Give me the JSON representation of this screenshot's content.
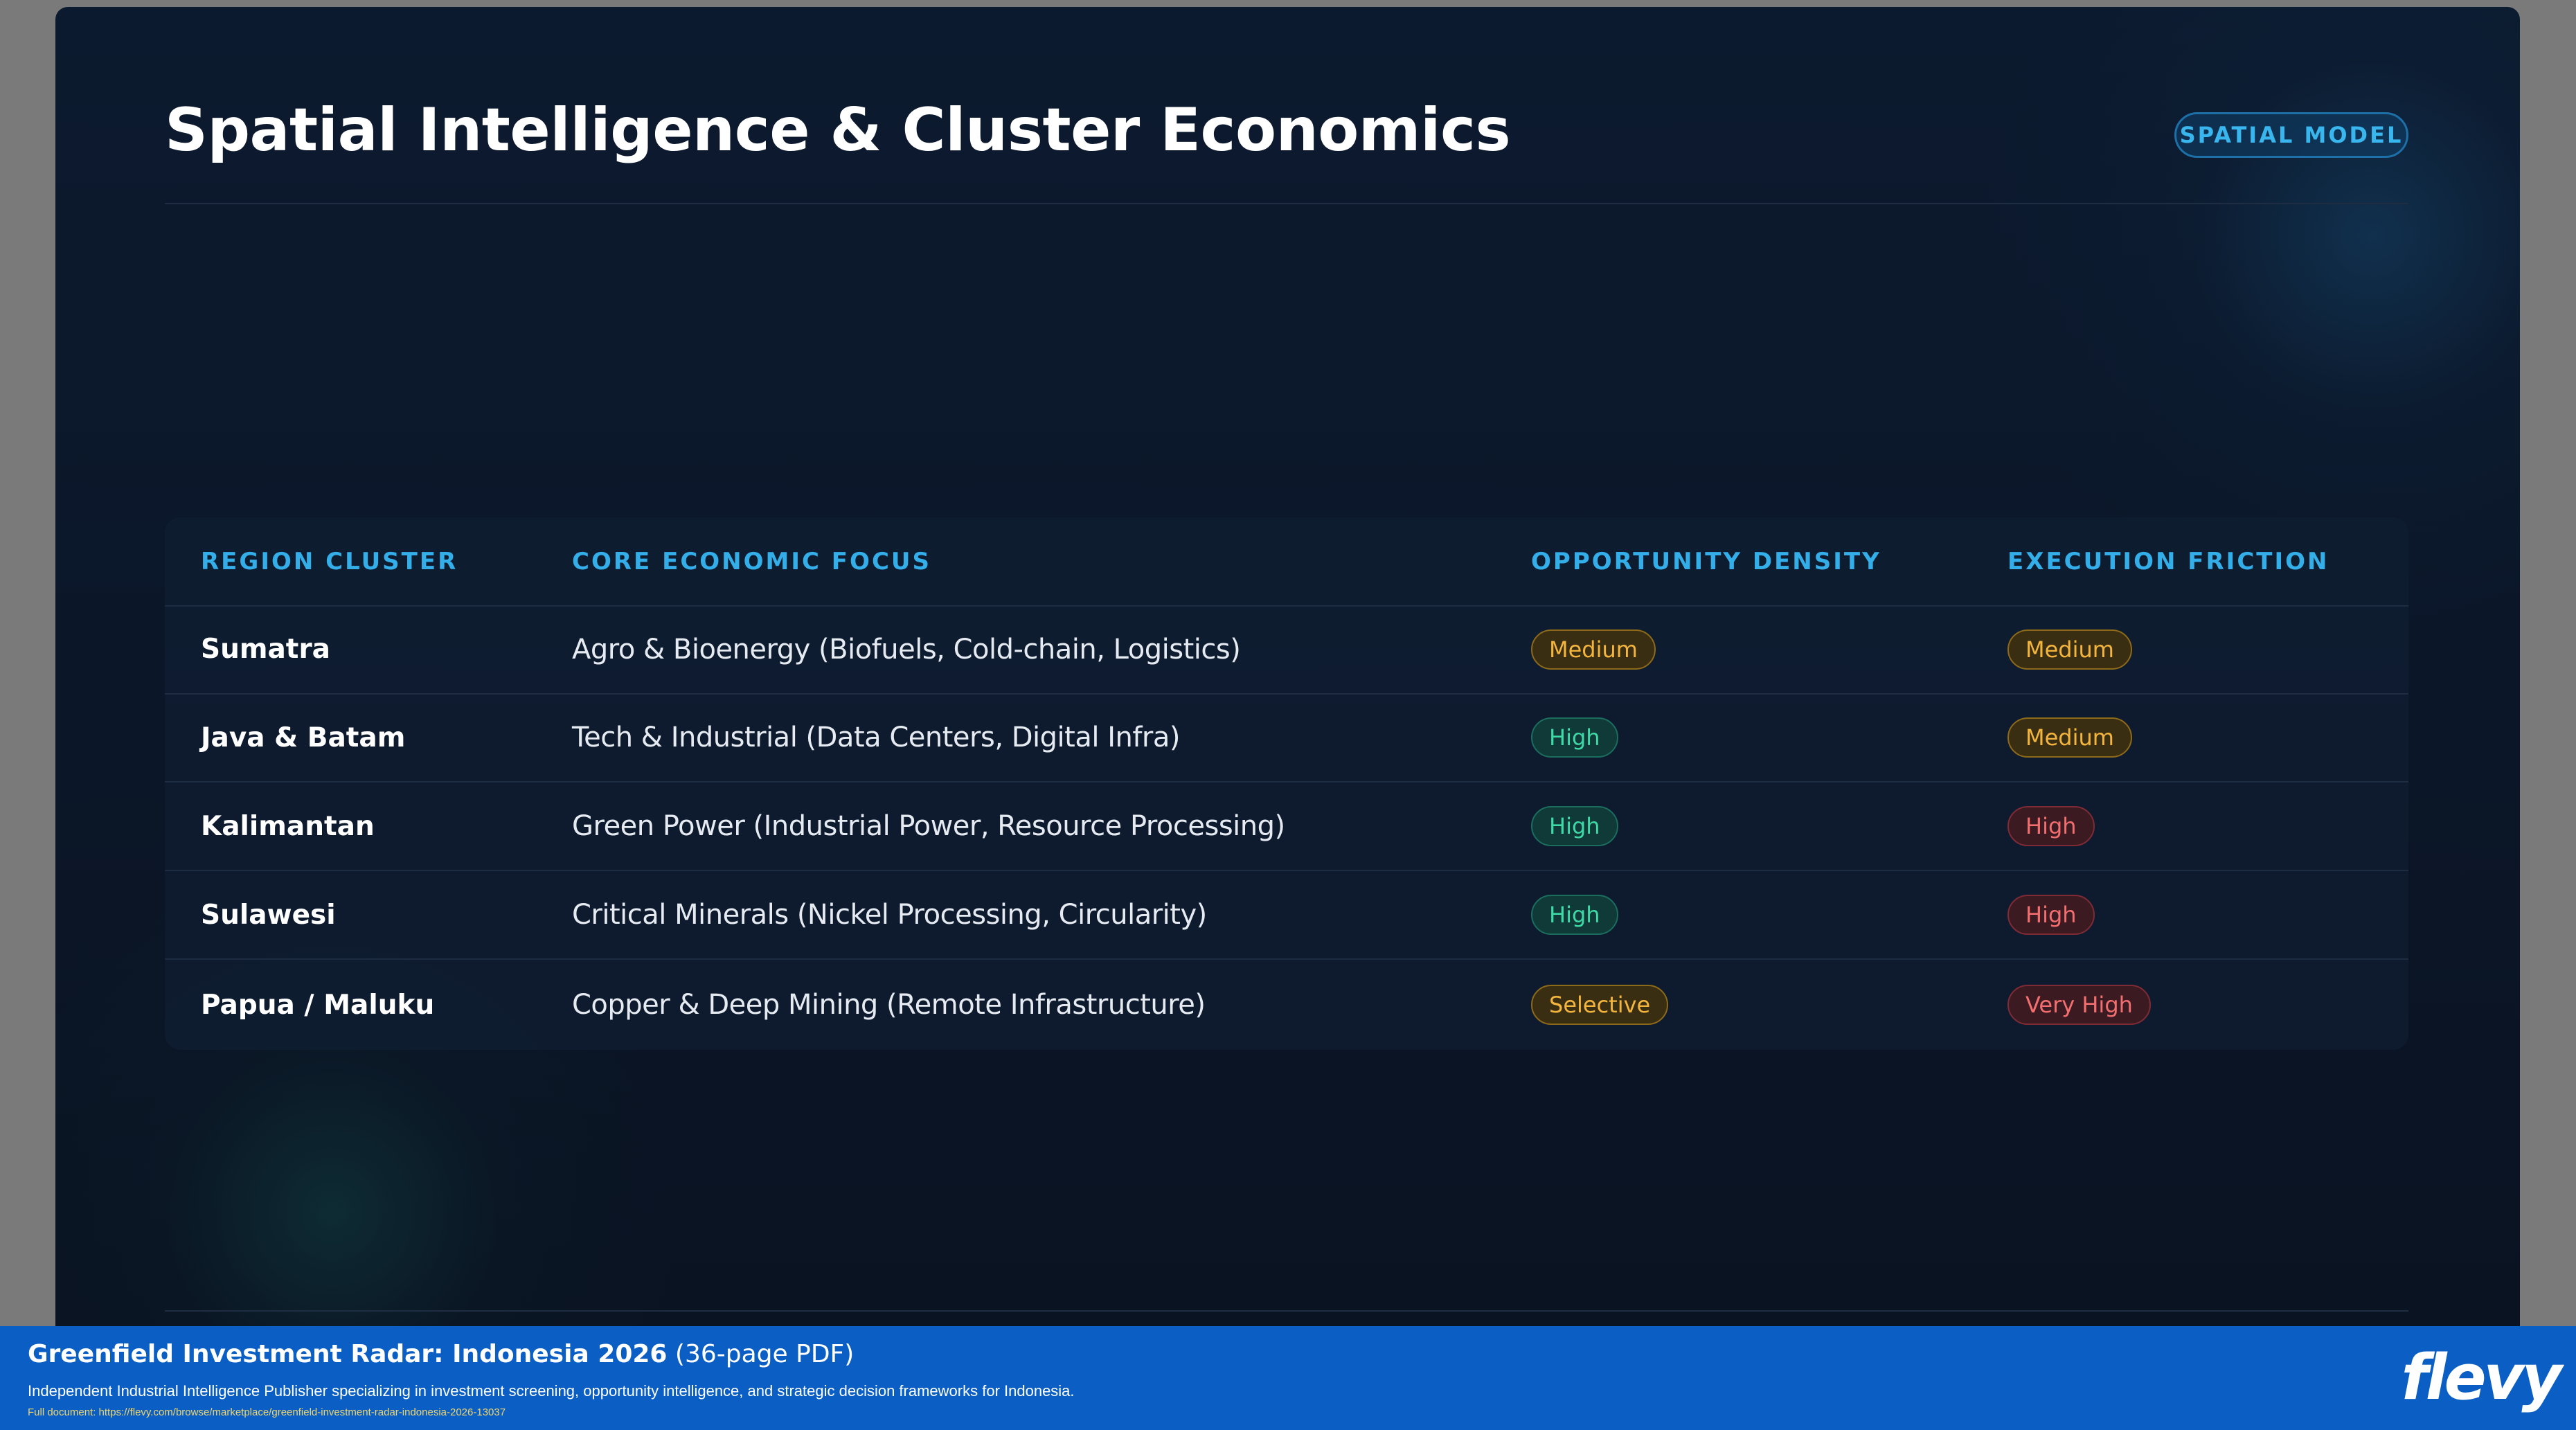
{
  "slide": {
    "title": "Spatial Intelligence & Cluster Economics",
    "badge": "SPATIAL MODEL"
  },
  "table": {
    "headers": [
      "REGION CLUSTER",
      "CORE ECONOMIC FOCUS",
      "OPPORTUNITY DENSITY",
      "EXECUTION FRICTION"
    ],
    "rows": [
      {
        "region": "Sumatra",
        "focus": "Agro & Bioenergy (Biofuels, Cold-chain, Logistics)",
        "opportunity": "Medium",
        "friction": "Medium"
      },
      {
        "region": "Java & Batam",
        "focus": "Tech & Industrial (Data Centers, Digital Infra)",
        "opportunity": "High",
        "friction": "Medium"
      },
      {
        "region": "Kalimantan",
        "focus": "Green Power (Industrial Power, Resource Processing)",
        "opportunity": "High",
        "friction": "High"
      },
      {
        "region": "Sulawesi",
        "focus": "Critical Minerals (Nickel Processing, Circularity)",
        "opportunity": "High",
        "friction": "High"
      },
      {
        "region": "Papua / Maluku",
        "focus": "Copper & Deep Mining (Remote Infrastructure)",
        "opportunity": "Selective",
        "friction": "Very High"
      }
    ]
  },
  "footer": {
    "title": "Greenfield Investment Radar: Indonesia 2026",
    "title_suffix": "(36-page PDF)",
    "subtitle": "Independent Industrial Intelligence Publisher specializing in investment screening, opportunity intelligence, and strategic decision frameworks for Indonesia.",
    "link": "Full document: https://flevy.com/browse/marketplace/greenfield-investment-radar-indonesia-2026-13037",
    "logo": "flevy"
  },
  "colors": {
    "accent": "#34aee8",
    "medium": "#f3b53e",
    "high_opportunity": "#3fd9a8",
    "high_friction": "#f36f6f",
    "footer_bg": "#0b5fc4"
  }
}
